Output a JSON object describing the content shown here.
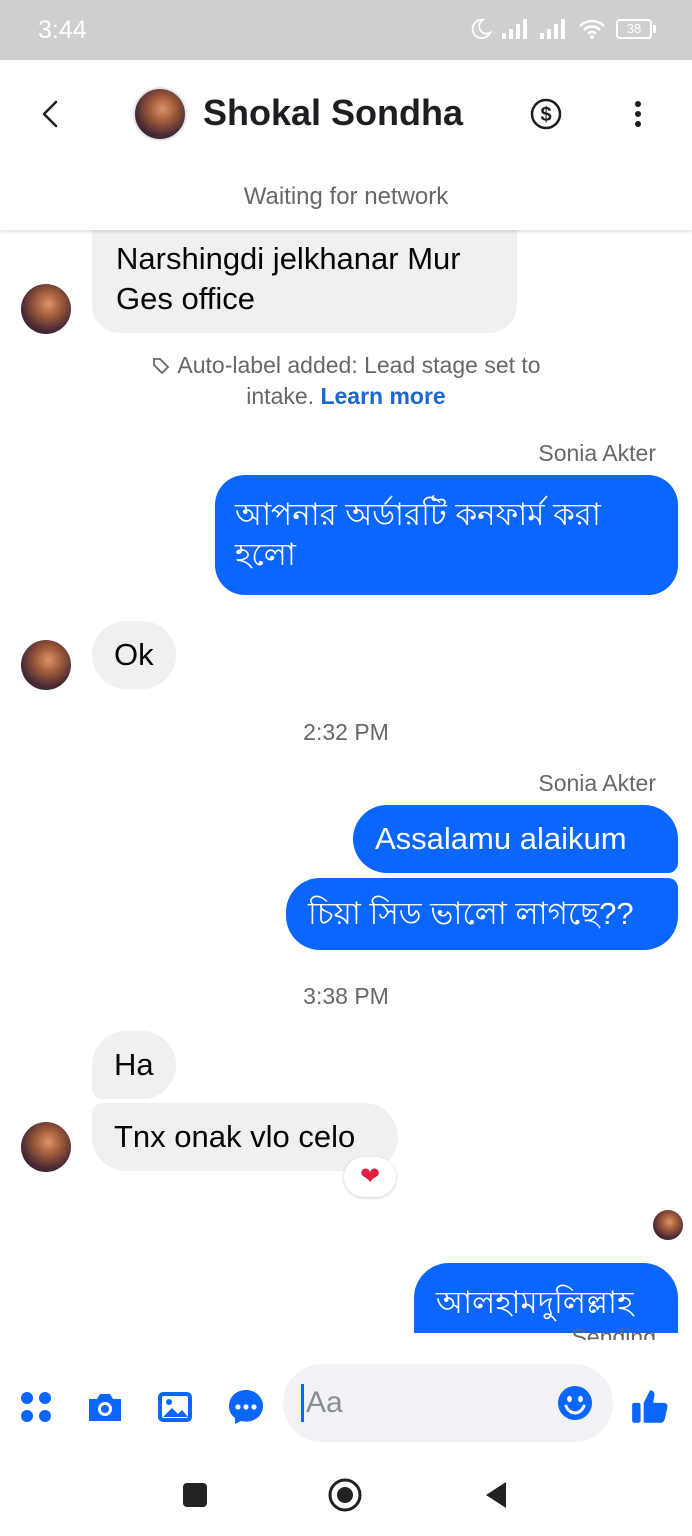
{
  "status_bar": {
    "time": "3:44",
    "battery": "38"
  },
  "header": {
    "contact_name": "Shokal Sondha",
    "network_status": "Waiting for network"
  },
  "messages": {
    "m1": {
      "line1": "Narshingdi jelkhanar Mur",
      "line2": "Ges office"
    },
    "auto_label": {
      "line1": "Auto-label added: Lead stage set to",
      "line2_prefix": "intake.",
      "learn_more": "Learn more"
    },
    "sender1": "Sonia Akter",
    "m2": {
      "line1": "আপনার অর্ডারটি কনফার্ম করা",
      "line2": "হলো"
    },
    "m3": "Ok",
    "time1": "2:32 PM",
    "sender2": "Sonia Akter",
    "m4": "Assalamu alaikum",
    "m5": "চিয়া সিড ভালো লাগছে??",
    "time2": "3:38 PM",
    "m6": "Ha",
    "m7": "Tnx onak vlo celo",
    "m7_reaction": "❤",
    "m8": "আলহামদুলিল্লাহ",
    "m8_status": "Sending"
  },
  "composer": {
    "placeholder": "Aa"
  },
  "colors": {
    "accent": "#0a66ff",
    "incoming_bubble": "#f0f0f2",
    "reaction": "#e41e3f"
  },
  "icons": [
    "back-arrow-icon",
    "dollar-icon",
    "more-vert-icon",
    "menu-grid-icon",
    "camera-icon",
    "gallery-icon",
    "chat-more-icon",
    "emoji-icon",
    "like-icon",
    "recents-icon",
    "home-icon",
    "nav-back-icon"
  ]
}
